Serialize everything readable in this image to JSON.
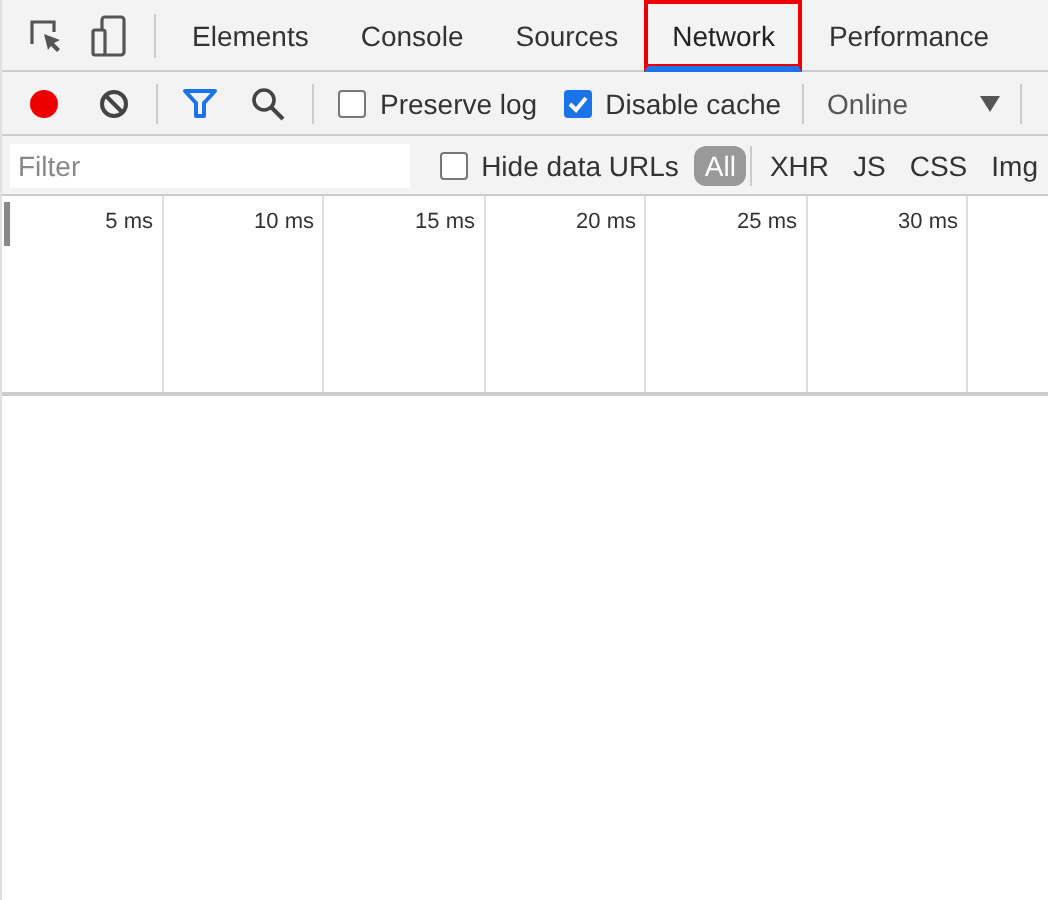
{
  "tabs": [
    {
      "label": "Elements",
      "selected": false
    },
    {
      "label": "Console",
      "selected": false
    },
    {
      "label": "Sources",
      "selected": false
    },
    {
      "label": "Network",
      "selected": true
    },
    {
      "label": "Performance",
      "selected": false
    }
  ],
  "toolbar": {
    "recording": true,
    "filter_active": true,
    "preserve_log": {
      "label": "Preserve log",
      "checked": false
    },
    "disable_cache": {
      "label": "Disable cache",
      "checked": true
    },
    "throttling": {
      "value": "Online"
    }
  },
  "filter_bar": {
    "placeholder": "Filter",
    "hide_data_urls": {
      "label": "Hide data URLs",
      "checked": false
    },
    "types": [
      {
        "label": "All",
        "selected": true
      },
      {
        "label": "XHR",
        "selected": false
      },
      {
        "label": "JS",
        "selected": false
      },
      {
        "label": "CSS",
        "selected": false
      },
      {
        "label": "Img",
        "selected": false
      }
    ]
  },
  "timeline": {
    "ticks": [
      "5 ms",
      "10 ms",
      "15 ms",
      "20 ms",
      "25 ms",
      "30 ms"
    ]
  }
}
